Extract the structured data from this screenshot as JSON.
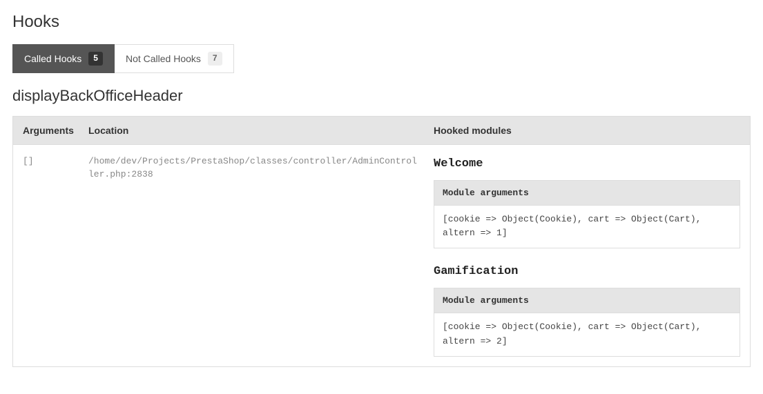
{
  "page_title": "Hooks",
  "tabs": {
    "called": {
      "label": "Called Hooks",
      "count": "5"
    },
    "not_called": {
      "label": "Not Called Hooks",
      "count": "7"
    }
  },
  "hook": {
    "name": "displayBackOfficeHeader",
    "headers": {
      "arguments": "Arguments",
      "location": "Location",
      "hooked_modules": "Hooked modules"
    },
    "arguments": "[]",
    "location": "/home/dev/Projects/PrestaShop/classes/controller/AdminController.php:2838",
    "modules": [
      {
        "title": "Welcome",
        "args_label": "Module arguments",
        "args": "[cookie => Object(Cookie), cart => Object(Cart), altern => 1]"
      },
      {
        "title": "Gamification",
        "args_label": "Module arguments",
        "args": "[cookie => Object(Cookie), cart => Object(Cart), altern => 2]"
      }
    ]
  }
}
